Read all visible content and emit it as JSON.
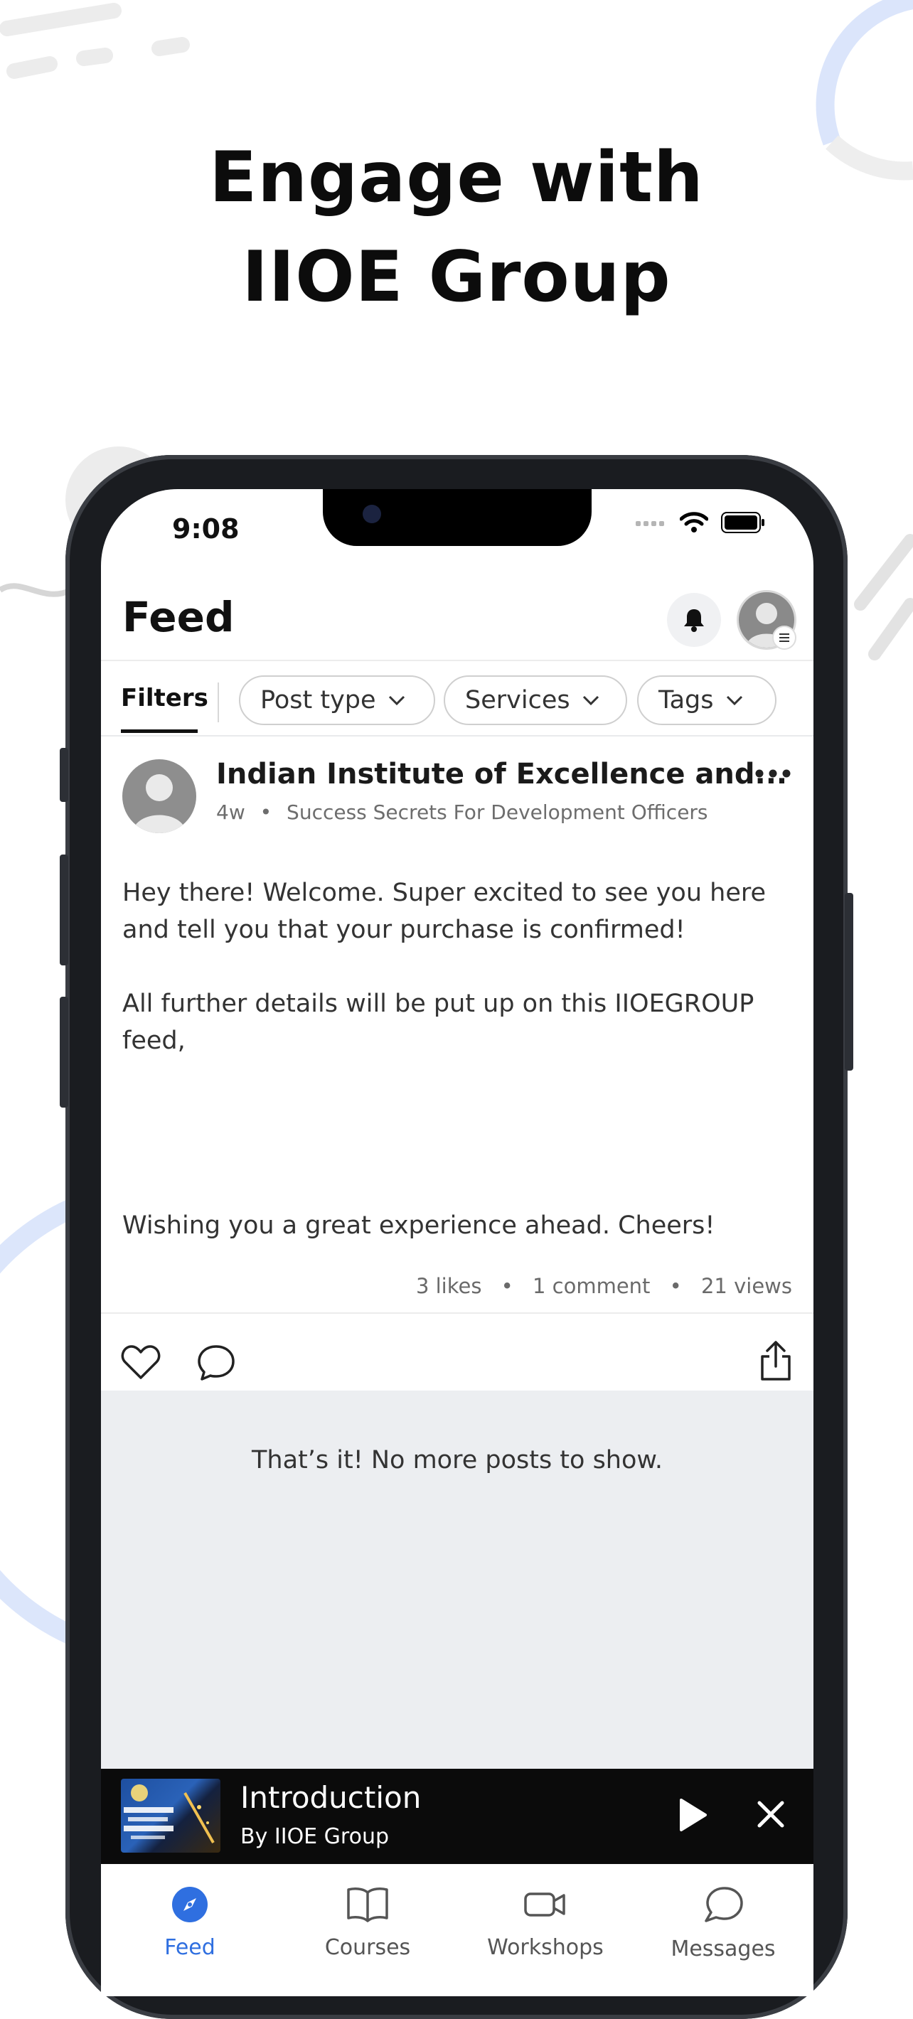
{
  "headline": {
    "line1": "Engage with",
    "line2": "IIOE Group"
  },
  "status_bar": {
    "time": "9:08"
  },
  "app_bar": {
    "title": "Feed"
  },
  "filters": {
    "tab_label": "Filters",
    "chips": [
      {
        "label": "Post type"
      },
      {
        "label": "Services"
      },
      {
        "label": "Tags"
      }
    ]
  },
  "post": {
    "author": "Indian Institute of Excellence and...",
    "age": "4w",
    "meta_separator": "•",
    "source": "Success Secrets For Development Officers",
    "body_1": "Hey there! Welcome. Super excited to see you here and tell you that your purchase is confirmed!",
    "body_2": "All further details will be put up on this IIOEGROUP feed,",
    "body_3": "Wishing you a great experience ahead. Cheers!",
    "likes": "3 likes",
    "comments": "1 comment",
    "views": "21 views",
    "stat_separator": "•"
  },
  "feed_end_message": "That’s it! No more posts to show.",
  "mini_player": {
    "title": "Introduction",
    "subtitle": "By IIOE Group"
  },
  "tabs": [
    {
      "label": "Feed",
      "icon": "compass-icon",
      "active": true
    },
    {
      "label": "Courses",
      "icon": "book-icon",
      "active": false
    },
    {
      "label": "Workshops",
      "icon": "video-camera-icon",
      "active": false
    },
    {
      "label": "Messages",
      "icon": "chat-bubble-icon",
      "active": false
    }
  ],
  "colors": {
    "accent": "#2f6fe0",
    "feed_background": "#eceef1",
    "player_background": "#0b0b0b",
    "decor_blue": "#dce6fb"
  }
}
